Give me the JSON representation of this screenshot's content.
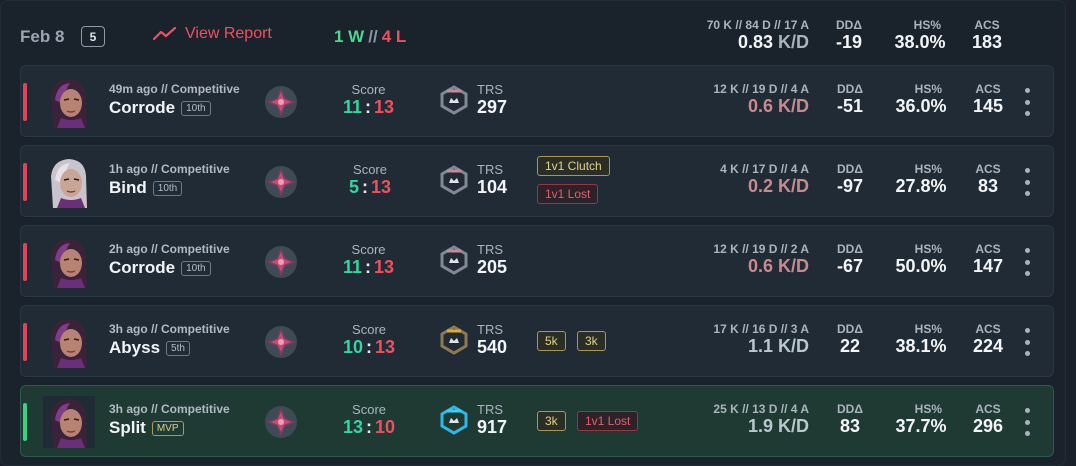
{
  "header": {
    "date": "Feb 8",
    "match_count": "5",
    "view_report": "View Report",
    "wins": "1 W",
    "separator": "//",
    "losses": "4 L",
    "kda_line": "70 K // 84 D // 17 A",
    "kd_value": "0.83",
    "kd_unit": "K/D",
    "ddd_label": "DDΔ",
    "ddd_value": "-19",
    "hs_label": "HS%",
    "hs_value": "38.0%",
    "acs_label": "ACS",
    "acs_value": "183"
  },
  "labels": {
    "score": "Score",
    "trs": "TRS",
    "ddd": "DDΔ",
    "hs": "HS%",
    "acs": "ACS"
  },
  "colors": {
    "win": "#4ed68b",
    "loss": "#f0505e",
    "accent_red": "#e04455",
    "accent_green": "#3ecf7f"
  },
  "matches": [
    {
      "meta": "49m ago // Competitive",
      "map": "Corrode",
      "placement": "10th",
      "score_a": "11",
      "score_sep": ":",
      "score_b": "13",
      "trs": "297",
      "trs_icon": "trs-rank-icon-silver",
      "tags": [],
      "kda": "12 K // 19 D // 4 A",
      "kd": "0.6 K/D",
      "ddd": "-51",
      "hs": "36.0%",
      "acs": "145",
      "result": "loss"
    },
    {
      "meta": "1h ago // Competitive",
      "map": "Bind",
      "placement": "10th",
      "score_a": "5",
      "score_sep": ":",
      "score_b": "13",
      "trs": "104",
      "trs_icon": "trs-rank-icon-silver",
      "tags": [
        "1v1 Clutch",
        "1v1 Lost"
      ],
      "kda": "4 K // 17 D // 4 A",
      "kd": "0.2 K/D",
      "ddd": "-97",
      "hs": "27.8%",
      "acs": "83",
      "result": "loss"
    },
    {
      "meta": "2h ago // Competitive",
      "map": "Corrode",
      "placement": "10th",
      "score_a": "11",
      "score_sep": ":",
      "score_b": "13",
      "trs": "205",
      "trs_icon": "trs-rank-icon-silver",
      "tags": [],
      "kda": "12 K // 19 D // 2 A",
      "kd": "0.6 K/D",
      "ddd": "-67",
      "hs": "50.0%",
      "acs": "147",
      "result": "loss"
    },
    {
      "meta": "3h ago // Competitive",
      "map": "Abyss",
      "placement": "5th",
      "score_a": "10",
      "score_sep": ":",
      "score_b": "13",
      "trs": "540",
      "trs_icon": "trs-rank-icon-gold",
      "tags": [
        "5k",
        "3k"
      ],
      "kda": "17 K // 16 D // 3 A",
      "kd": "1.1 K/D",
      "ddd": "22",
      "hs": "38.1%",
      "acs": "224",
      "result": "loss"
    },
    {
      "meta": "3h ago // Competitive",
      "map": "Split",
      "placement": "MVP",
      "score_a": "13",
      "score_sep": ":",
      "score_b": "10",
      "trs": "917",
      "trs_icon": "trs-rank-icon-diamond",
      "tags": [
        "3k",
        "1v1 Lost"
      ],
      "kda": "25 K // 13 D // 4 A",
      "kd": "1.9 K/D",
      "ddd": "83",
      "hs": "37.7%",
      "acs": "296",
      "result": "win"
    }
  ]
}
